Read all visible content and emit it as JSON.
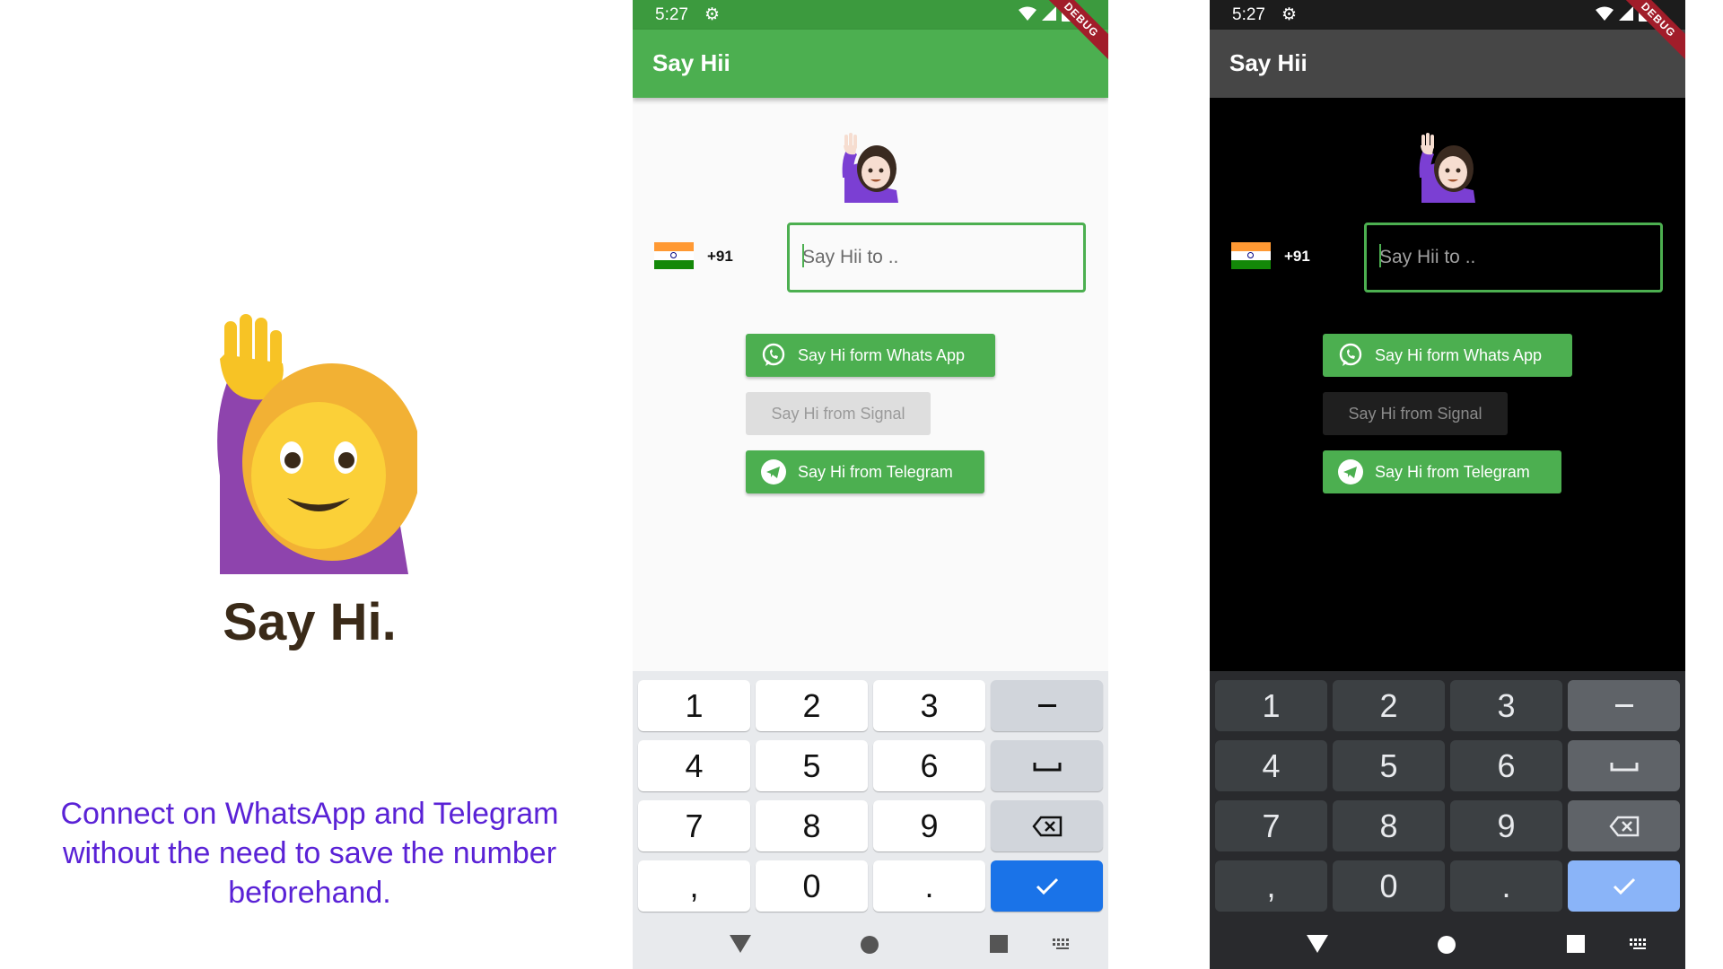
{
  "promo": {
    "title": "Say Hi.",
    "description": "Connect on WhatsApp and Telegram without the need to save the number beforehand."
  },
  "phones": {
    "light": {
      "status_time": "5:27",
      "app_title": "Say Hii",
      "debug_label": "DEBUG",
      "country_code": "+91",
      "input_placeholder": "Say Hii to ..",
      "whatsapp_label": "Say Hi form Whats App",
      "signal_label": "Say Hi from Signal",
      "telegram_label": "Say Hi from Telegram"
    },
    "dark": {
      "status_time": "5:27",
      "app_title": "Say Hii",
      "debug_label": "DEBUG",
      "country_code": "+91",
      "input_placeholder": "Say Hii to ..",
      "whatsapp_label": "Say Hi form Whats App",
      "signal_label": "Say Hi from Signal",
      "telegram_label": "Say Hi from Telegram"
    }
  },
  "keyboard": {
    "keys": [
      "1",
      "2",
      "3",
      "4",
      "5",
      "6",
      "7",
      "8",
      "9",
      ",",
      "0",
      "."
    ]
  },
  "colors": {
    "accent_green": "#4caf50",
    "statusbar_green": "#3c9a3e",
    "dark_appbar": "#464646",
    "promo_text": "#5a22d6",
    "enter_key_light": "#1a73e8",
    "enter_key_dark": "#8ab4f8"
  },
  "icons": [
    "gear-icon",
    "wifi-icon",
    "signal-icon",
    "battery-icon",
    "woman-raising-hand-icon",
    "india-flag-icon",
    "whatsapp-icon",
    "telegram-icon",
    "minus-icon",
    "space-icon",
    "backspace-icon",
    "check-icon",
    "nav-back-icon",
    "nav-home-icon",
    "nav-recents-icon",
    "keyboard-switch-icon"
  ]
}
